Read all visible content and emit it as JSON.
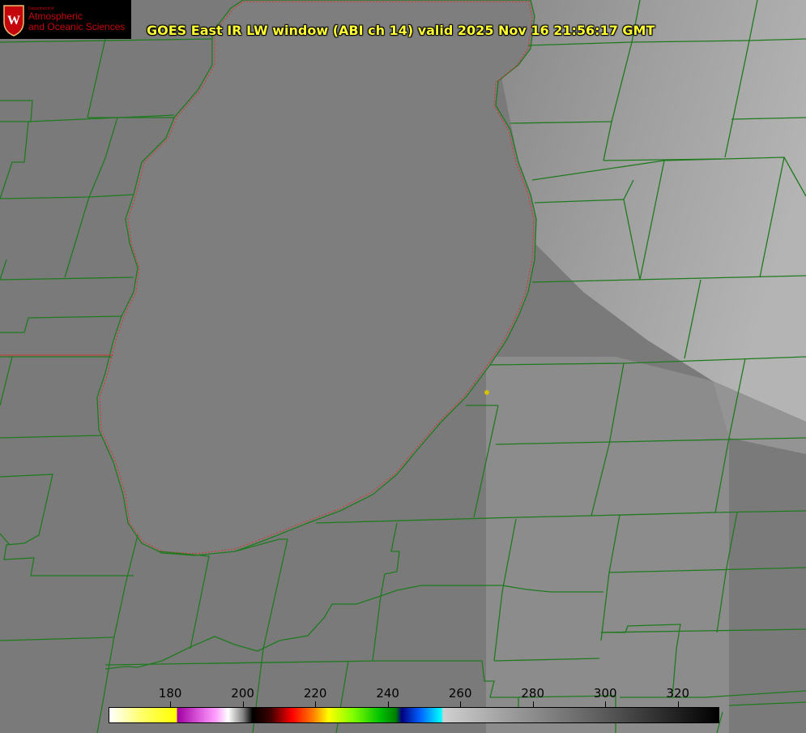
{
  "logo": {
    "department": "Department of",
    "line1": "Atmospheric",
    "line2": "and Oceanic Sciences",
    "seal_letter": "W",
    "seal_color": "#c5050c"
  },
  "title": "GOES East IR LW window (ABI ch 14) valid 2025 Nov 16 21:56:17 GMT",
  "colorbar": {
    "ticks": [
      "180",
      "200",
      "220",
      "240",
      "260",
      "280",
      "300",
      "320"
    ],
    "range": [
      163,
      331
    ]
  },
  "colors": {
    "title": "#ffff33",
    "boundaries": "#1f7a1f",
    "coastline_dotted": "#e03030",
    "marker": "#d4c000",
    "lake": "#7e7e7e",
    "land": "#7a7a7a",
    "cloud": "#a8a8a8"
  }
}
